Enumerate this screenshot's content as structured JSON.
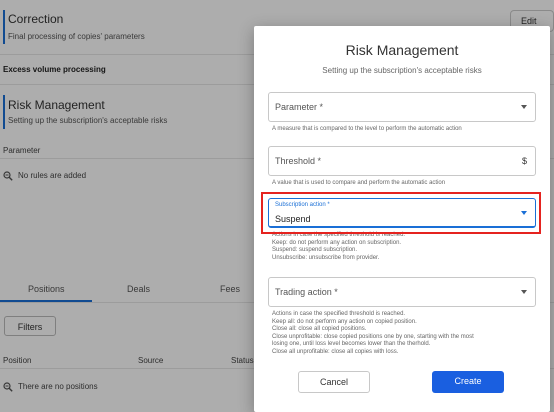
{
  "background": {
    "correction": {
      "title": "Correction",
      "subtitle": "Final processing of copies' parameters",
      "edit_label": "Edit"
    },
    "excess_volume": "Excess volume processing",
    "risk": {
      "title": "Risk Management",
      "subtitle": "Setting up the subscription's acceptable risks"
    },
    "parameter_header": "Parameter",
    "no_rules": "No rules are added",
    "tabs": [
      "Positions",
      "Deals",
      "Fees"
    ],
    "filters_label": "Filters",
    "columns": [
      "Position",
      "Source",
      "Status"
    ],
    "no_positions": "There are no positions"
  },
  "modal": {
    "title": "Risk Management",
    "subtitle": "Setting up the subscription's acceptable risks",
    "parameter": {
      "label": "Parameter *",
      "helper": "A measure that is compared to the level to perform the automatic action"
    },
    "threshold": {
      "label": "Threshold *",
      "suffix": "$",
      "helper": "A value that is used to compare and perform the automatic action"
    },
    "subscription_action": {
      "label": "Subscription action *",
      "value": "Suspend",
      "helper": [
        "Actions in case the specified threshold is reached.",
        "Keep: do not perform any action on subscription.",
        "Suspend: suspend subscription.",
        "Unsubscribe: unsubscribe from provider."
      ]
    },
    "trading_action": {
      "label": "Trading action *",
      "helper": [
        "Actions in case the specified threshold is reached.",
        "Keep all: do not perform any action on copied position.",
        "Close all: close all copied positions.",
        "Close unprofitable: close copied positions one by one, starting with the most",
        "losing one, until loss level becomes lower than the therhold.",
        "Close all unprofitable: close all copies with loss."
      ]
    },
    "cancel_label": "Cancel",
    "create_label": "Create"
  },
  "colors": {
    "accent": "#1a6fd6",
    "primary_button": "#1a5fe0",
    "highlight": "#e5231f"
  },
  "icons": {
    "empty_state": "magnifier-minus-icon",
    "dropdown": "caret-down-icon"
  }
}
